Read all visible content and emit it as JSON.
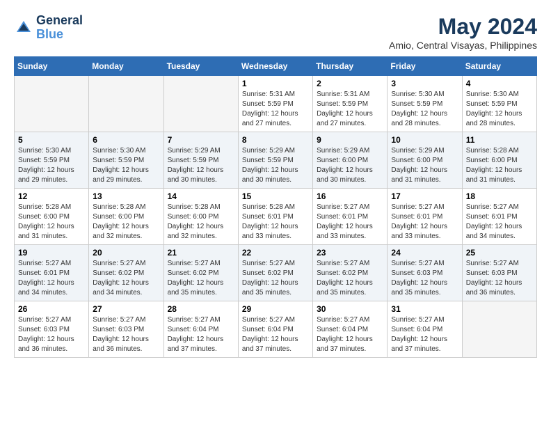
{
  "header": {
    "logo": {
      "line1": "General",
      "line2": "Blue"
    },
    "title": "May 2024",
    "location": "Amio, Central Visayas, Philippines"
  },
  "weekdays": [
    "Sunday",
    "Monday",
    "Tuesday",
    "Wednesday",
    "Thursday",
    "Friday",
    "Saturday"
  ],
  "weeks": [
    [
      {
        "day": "",
        "sunrise": "",
        "sunset": "",
        "daylight": ""
      },
      {
        "day": "",
        "sunrise": "",
        "sunset": "",
        "daylight": ""
      },
      {
        "day": "",
        "sunrise": "",
        "sunset": "",
        "daylight": ""
      },
      {
        "day": "1",
        "sunrise": "5:31 AM",
        "sunset": "5:59 PM",
        "daylight": "12 hours and 27 minutes."
      },
      {
        "day": "2",
        "sunrise": "5:31 AM",
        "sunset": "5:59 PM",
        "daylight": "12 hours and 27 minutes."
      },
      {
        "day": "3",
        "sunrise": "5:30 AM",
        "sunset": "5:59 PM",
        "daylight": "12 hours and 28 minutes."
      },
      {
        "day": "4",
        "sunrise": "5:30 AM",
        "sunset": "5:59 PM",
        "daylight": "12 hours and 28 minutes."
      }
    ],
    [
      {
        "day": "5",
        "sunrise": "5:30 AM",
        "sunset": "5:59 PM",
        "daylight": "12 hours and 29 minutes."
      },
      {
        "day": "6",
        "sunrise": "5:30 AM",
        "sunset": "5:59 PM",
        "daylight": "12 hours and 29 minutes."
      },
      {
        "day": "7",
        "sunrise": "5:29 AM",
        "sunset": "5:59 PM",
        "daylight": "12 hours and 30 minutes."
      },
      {
        "day": "8",
        "sunrise": "5:29 AM",
        "sunset": "5:59 PM",
        "daylight": "12 hours and 30 minutes."
      },
      {
        "day": "9",
        "sunrise": "5:29 AM",
        "sunset": "6:00 PM",
        "daylight": "12 hours and 30 minutes."
      },
      {
        "day": "10",
        "sunrise": "5:29 AM",
        "sunset": "6:00 PM",
        "daylight": "12 hours and 31 minutes."
      },
      {
        "day": "11",
        "sunrise": "5:28 AM",
        "sunset": "6:00 PM",
        "daylight": "12 hours and 31 minutes."
      }
    ],
    [
      {
        "day": "12",
        "sunrise": "5:28 AM",
        "sunset": "6:00 PM",
        "daylight": "12 hours and 31 minutes."
      },
      {
        "day": "13",
        "sunrise": "5:28 AM",
        "sunset": "6:00 PM",
        "daylight": "12 hours and 32 minutes."
      },
      {
        "day": "14",
        "sunrise": "5:28 AM",
        "sunset": "6:00 PM",
        "daylight": "12 hours and 32 minutes."
      },
      {
        "day": "15",
        "sunrise": "5:28 AM",
        "sunset": "6:01 PM",
        "daylight": "12 hours and 33 minutes."
      },
      {
        "day": "16",
        "sunrise": "5:27 AM",
        "sunset": "6:01 PM",
        "daylight": "12 hours and 33 minutes."
      },
      {
        "day": "17",
        "sunrise": "5:27 AM",
        "sunset": "6:01 PM",
        "daylight": "12 hours and 33 minutes."
      },
      {
        "day": "18",
        "sunrise": "5:27 AM",
        "sunset": "6:01 PM",
        "daylight": "12 hours and 34 minutes."
      }
    ],
    [
      {
        "day": "19",
        "sunrise": "5:27 AM",
        "sunset": "6:01 PM",
        "daylight": "12 hours and 34 minutes."
      },
      {
        "day": "20",
        "sunrise": "5:27 AM",
        "sunset": "6:02 PM",
        "daylight": "12 hours and 34 minutes."
      },
      {
        "day": "21",
        "sunrise": "5:27 AM",
        "sunset": "6:02 PM",
        "daylight": "12 hours and 35 minutes."
      },
      {
        "day": "22",
        "sunrise": "5:27 AM",
        "sunset": "6:02 PM",
        "daylight": "12 hours and 35 minutes."
      },
      {
        "day": "23",
        "sunrise": "5:27 AM",
        "sunset": "6:02 PM",
        "daylight": "12 hours and 35 minutes."
      },
      {
        "day": "24",
        "sunrise": "5:27 AM",
        "sunset": "6:03 PM",
        "daylight": "12 hours and 35 minutes."
      },
      {
        "day": "25",
        "sunrise": "5:27 AM",
        "sunset": "6:03 PM",
        "daylight": "12 hours and 36 minutes."
      }
    ],
    [
      {
        "day": "26",
        "sunrise": "5:27 AM",
        "sunset": "6:03 PM",
        "daylight": "12 hours and 36 minutes."
      },
      {
        "day": "27",
        "sunrise": "5:27 AM",
        "sunset": "6:03 PM",
        "daylight": "12 hours and 36 minutes."
      },
      {
        "day": "28",
        "sunrise": "5:27 AM",
        "sunset": "6:04 PM",
        "daylight": "12 hours and 37 minutes."
      },
      {
        "day": "29",
        "sunrise": "5:27 AM",
        "sunset": "6:04 PM",
        "daylight": "12 hours and 37 minutes."
      },
      {
        "day": "30",
        "sunrise": "5:27 AM",
        "sunset": "6:04 PM",
        "daylight": "12 hours and 37 minutes."
      },
      {
        "day": "31",
        "sunrise": "5:27 AM",
        "sunset": "6:04 PM",
        "daylight": "12 hours and 37 minutes."
      },
      {
        "day": "",
        "sunrise": "",
        "sunset": "",
        "daylight": ""
      }
    ]
  ],
  "labels": {
    "sunrise_prefix": "Sunrise: ",
    "sunset_prefix": "Sunset: ",
    "daylight_prefix": "Daylight: "
  }
}
